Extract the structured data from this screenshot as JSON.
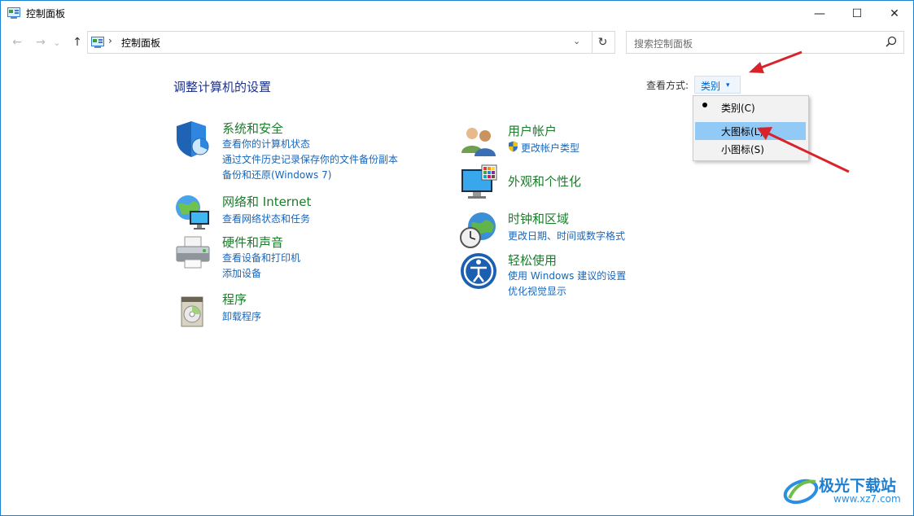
{
  "window": {
    "title": "控制面板",
    "controls": {
      "minimize": "—",
      "maximize": "☐",
      "close": "✕"
    }
  },
  "nav": {
    "back": "←",
    "forward": "→",
    "recent": "⌄",
    "up": "↑",
    "refresh": "↻"
  },
  "address": {
    "separator": "›",
    "path": "控制面板",
    "dropdown": "⌄"
  },
  "search": {
    "placeholder": "搜索控制面板"
  },
  "main": {
    "heading": "调整计算机的设置",
    "view_by_label": "查看方式:",
    "view_by_value": "类别",
    "view_by_arrow": "▾"
  },
  "view_menu": {
    "items": [
      {
        "label": "类别(C)",
        "selected": true
      },
      {
        "label": "大图标(L)",
        "highlighted": true
      },
      {
        "label": "小图标(S)"
      }
    ]
  },
  "categories_left": [
    {
      "title": "系统和安全",
      "icon": "shield-icon",
      "links": [
        "查看你的计算机状态",
        "通过文件历史记录保存你的文件备份副本",
        "备份和还原(Windows 7)"
      ]
    },
    {
      "title": "网络和 Internet",
      "icon": "network-globe-icon",
      "links": [
        "查看网络状态和任务"
      ]
    },
    {
      "title": "硬件和声音",
      "icon": "printer-icon",
      "links": [
        "查看设备和打印机",
        "添加设备"
      ]
    },
    {
      "title": "程序",
      "icon": "programs-icon",
      "links": [
        "卸载程序"
      ]
    }
  ],
  "categories_right": [
    {
      "title": "用户帐户",
      "icon": "users-icon",
      "links": [
        "更改帐户类型"
      ]
    },
    {
      "title": "外观和个性化",
      "icon": "monitor-palette-icon",
      "links": []
    },
    {
      "title": "时钟和区域",
      "icon": "clock-globe-icon",
      "links": [
        "更改日期、时间或数字格式"
      ]
    },
    {
      "title": "轻松使用",
      "icon": "ease-of-access-icon",
      "links": [
        "使用 Windows 建议的设置",
        "优化视觉显示"
      ]
    }
  ],
  "watermark": {
    "name": "极光下载站",
    "url": "www.xz7.com"
  },
  "colors": {
    "category_title": "#1b7c2b",
    "link": "#1a66b8",
    "heading": "#1e3287",
    "annotation_arrow": "#d9232a",
    "menu_highlight": "#91c9f7"
  }
}
